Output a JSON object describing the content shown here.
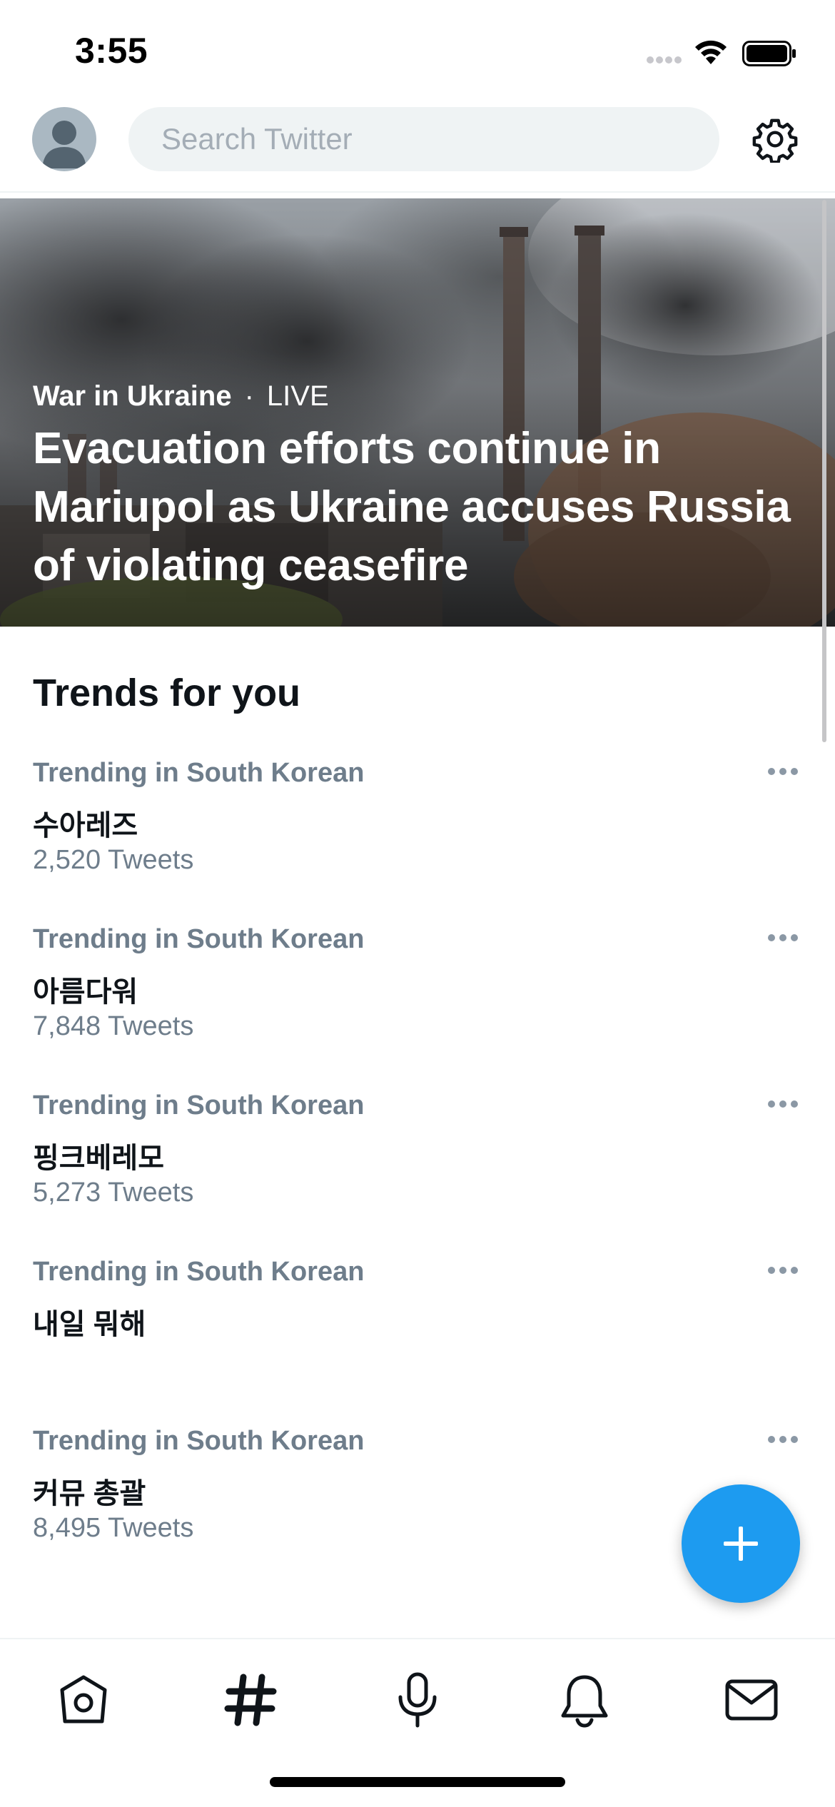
{
  "status_bar": {
    "time": "3:55"
  },
  "search": {
    "placeholder": "Search Twitter"
  },
  "hero": {
    "topic": "War in Ukraine",
    "separator": "·",
    "live_label": "LIVE",
    "headline": "Evacuation efforts continue in Mariupol as Ukraine accuses Russia of violating ceasefire"
  },
  "trends": {
    "title": "Trends for you",
    "items": [
      {
        "context": "Trending in South Korean",
        "name": "수아레즈",
        "count": "2,520 Tweets"
      },
      {
        "context": "Trending in South Korean",
        "name": "아름다워",
        "count": "7,848 Tweets"
      },
      {
        "context": "Trending in South Korean",
        "name": "핑크베레모",
        "count": "5,273 Tweets"
      },
      {
        "context": "Trending in South Korean",
        "name": "내일 뭐해",
        "count": ""
      },
      {
        "context": "Trending in South Korean",
        "name": "커뮤 총괄",
        "count": "8,495 Tweets"
      }
    ]
  },
  "tab_bar": {
    "icons": [
      "home-icon",
      "explore-hashtag-icon",
      "spaces-microphone-icon",
      "notifications-bell-icon",
      "messages-envelope-icon"
    ]
  },
  "colors": {
    "accent": "#1d9bf0",
    "secondary_text": "#6e7d8b",
    "primary_text": "#0f1419"
  }
}
